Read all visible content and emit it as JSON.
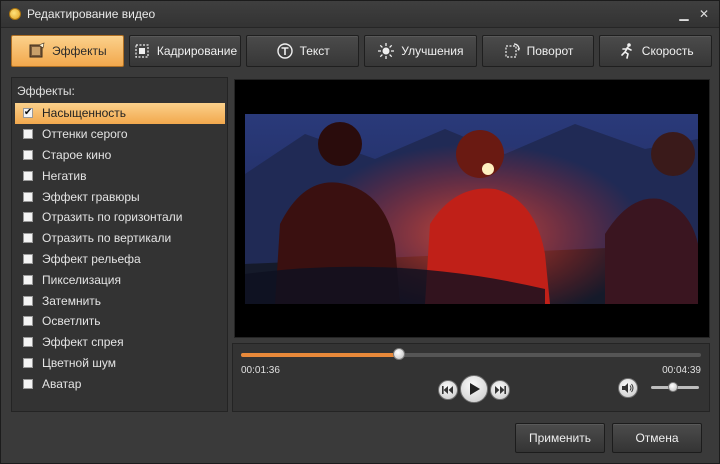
{
  "window": {
    "title": "Редактирование видео",
    "minimize_glyph": "▁",
    "close_glyph": "✕"
  },
  "tabs": [
    {
      "label": "Эффекты",
      "icon": "effects-icon",
      "active": true
    },
    {
      "label": "Кадрирование",
      "icon": "crop-icon",
      "active": false
    },
    {
      "label": "Текст",
      "icon": "text-icon",
      "active": false
    },
    {
      "label": "Улучшения",
      "icon": "enhance-icon",
      "active": false
    },
    {
      "label": "Поворот",
      "icon": "rotate-icon",
      "active": false
    },
    {
      "label": "Скорость",
      "icon": "speed-icon",
      "active": false
    }
  ],
  "effects_panel": {
    "title": "Эффекты:",
    "items": [
      {
        "label": "Насыщенность",
        "checked": true,
        "selected": true
      },
      {
        "label": "Оттенки серого",
        "checked": false,
        "selected": false
      },
      {
        "label": "Старое кино",
        "checked": false,
        "selected": false
      },
      {
        "label": "Негатив",
        "checked": false,
        "selected": false
      },
      {
        "label": "Эффект гравюры",
        "checked": false,
        "selected": false
      },
      {
        "label": "Отразить по горизонтали",
        "checked": false,
        "selected": false
      },
      {
        "label": "Отразить по вертикали",
        "checked": false,
        "selected": false
      },
      {
        "label": "Эффект рельефа",
        "checked": false,
        "selected": false
      },
      {
        "label": "Пикселизация",
        "checked": false,
        "selected": false
      },
      {
        "label": "Затемнить",
        "checked": false,
        "selected": false
      },
      {
        "label": "Осветлить",
        "checked": false,
        "selected": false
      },
      {
        "label": "Эффект спрея",
        "checked": false,
        "selected": false
      },
      {
        "label": "Цветной шум",
        "checked": false,
        "selected": false
      },
      {
        "label": "Аватар",
        "checked": false,
        "selected": false
      }
    ]
  },
  "player": {
    "current_time": "00:01:36",
    "total_time": "00:04:39",
    "progress": 0.344,
    "volume": 0.45,
    "progress_color": "#e8893a"
  },
  "footer": {
    "apply_label": "Применить",
    "cancel_label": "Отмена"
  },
  "colors": {
    "accent": "#f2a84d",
    "accent_light": "#fbd18b",
    "background": "#3a3a3a"
  }
}
